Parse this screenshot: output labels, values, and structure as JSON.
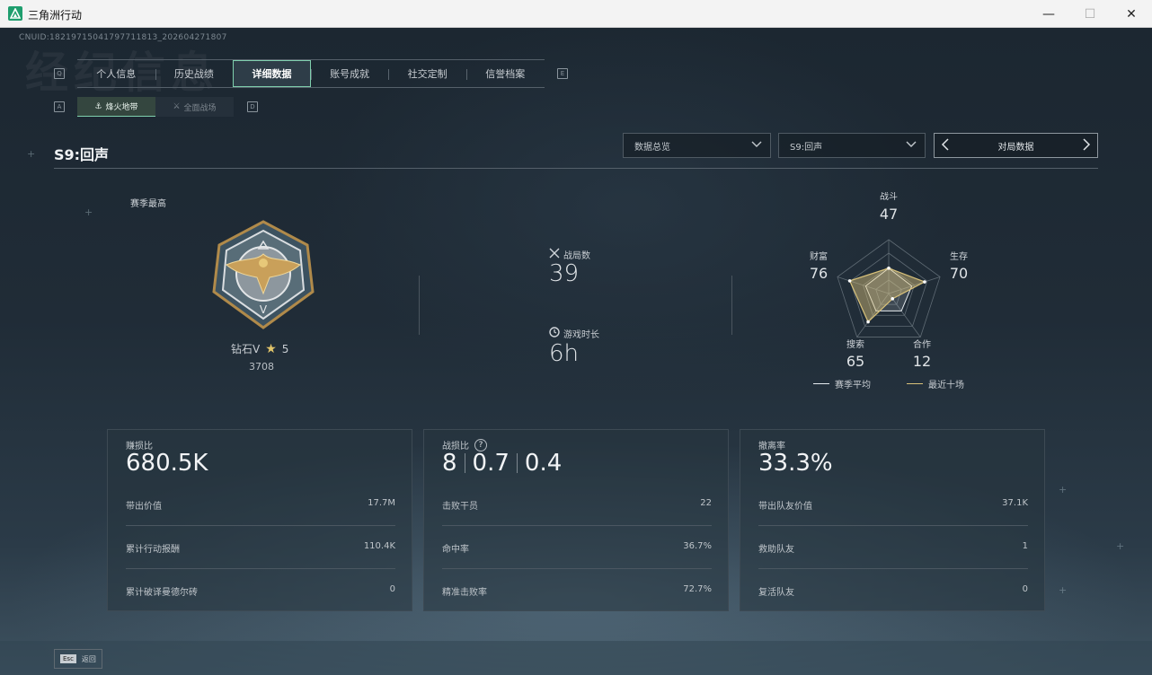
{
  "window": {
    "title": "三角洲行动",
    "min": "—",
    "max": "☐",
    "close": "✕"
  },
  "uid": "CNUID:18219715041797711813_202604271807",
  "bg_text": "经纪信息",
  "main_tabs": {
    "left_key": "Q",
    "right_key": "E",
    "items": [
      {
        "label": "个人信息"
      },
      {
        "label": "历史战绩"
      },
      {
        "label": "详细数据"
      },
      {
        "label": "账号成就"
      },
      {
        "label": "社交定制"
      },
      {
        "label": "信誉档案"
      }
    ]
  },
  "sub_tabs": {
    "left_key": "A",
    "right_key": "D",
    "items": [
      {
        "label": "烽火地带",
        "icon": "⚓"
      },
      {
        "label": "全面战场",
        "icon": "⚔"
      }
    ]
  },
  "season": {
    "title": "S9:回声"
  },
  "filters": {
    "dd1": "数据总览",
    "dd2": "S9:回声",
    "pager": "对局数据"
  },
  "rank": {
    "section_label": "赛季最高",
    "name": "钻石V",
    "stars": "5",
    "score": "3708"
  },
  "summary": {
    "matches_label": "战局数",
    "matches": "39",
    "time_label": "游戏时长",
    "time": "6h"
  },
  "radar": {
    "axes": [
      {
        "label": "战斗",
        "value": "47",
        "season_avg": 0.47,
        "recent": 0.47
      },
      {
        "label": "生存",
        "value": "70",
        "season_avg": 0.45,
        "recent": 0.7
      },
      {
        "label": "合作",
        "value": "12",
        "season_avg": 0.4,
        "recent": 0.12
      },
      {
        "label": "搜索",
        "value": "65",
        "season_avg": 0.4,
        "recent": 0.65
      },
      {
        "label": "财富",
        "value": "76",
        "season_avg": 0.45,
        "recent": 0.76
      }
    ],
    "legend_avg": "赛季平均",
    "legend_recent": "最近十场",
    "colors": {
      "avg": "#e6ebef",
      "recent": "#d9c27a"
    }
  },
  "cards": [
    {
      "title": "赚损比",
      "big": "680.5K",
      "rows": [
        {
          "label": "带出价值",
          "value": "17.7M"
        },
        {
          "label": "累计行动报酬",
          "value": "110.4K"
        },
        {
          "label": "累计破译曼德尔砖",
          "value": "0"
        }
      ]
    },
    {
      "title": "战损比",
      "big_parts": [
        "8",
        "0.7",
        "0.4"
      ],
      "help": "?",
      "rows": [
        {
          "label": "击败干员",
          "value": "22"
        },
        {
          "label": "命中率",
          "value": "36.7%"
        },
        {
          "label": "精准击败率",
          "value": "72.7%"
        }
      ]
    },
    {
      "title": "撤离率",
      "big": "33.3%",
      "rows": [
        {
          "label": "带出队友价值",
          "value": "37.1K"
        },
        {
          "label": "救助队友",
          "value": "1"
        },
        {
          "label": "复活队友",
          "value": "0"
        }
      ]
    }
  ],
  "footer": {
    "key": "Esc",
    "label": "返回"
  }
}
